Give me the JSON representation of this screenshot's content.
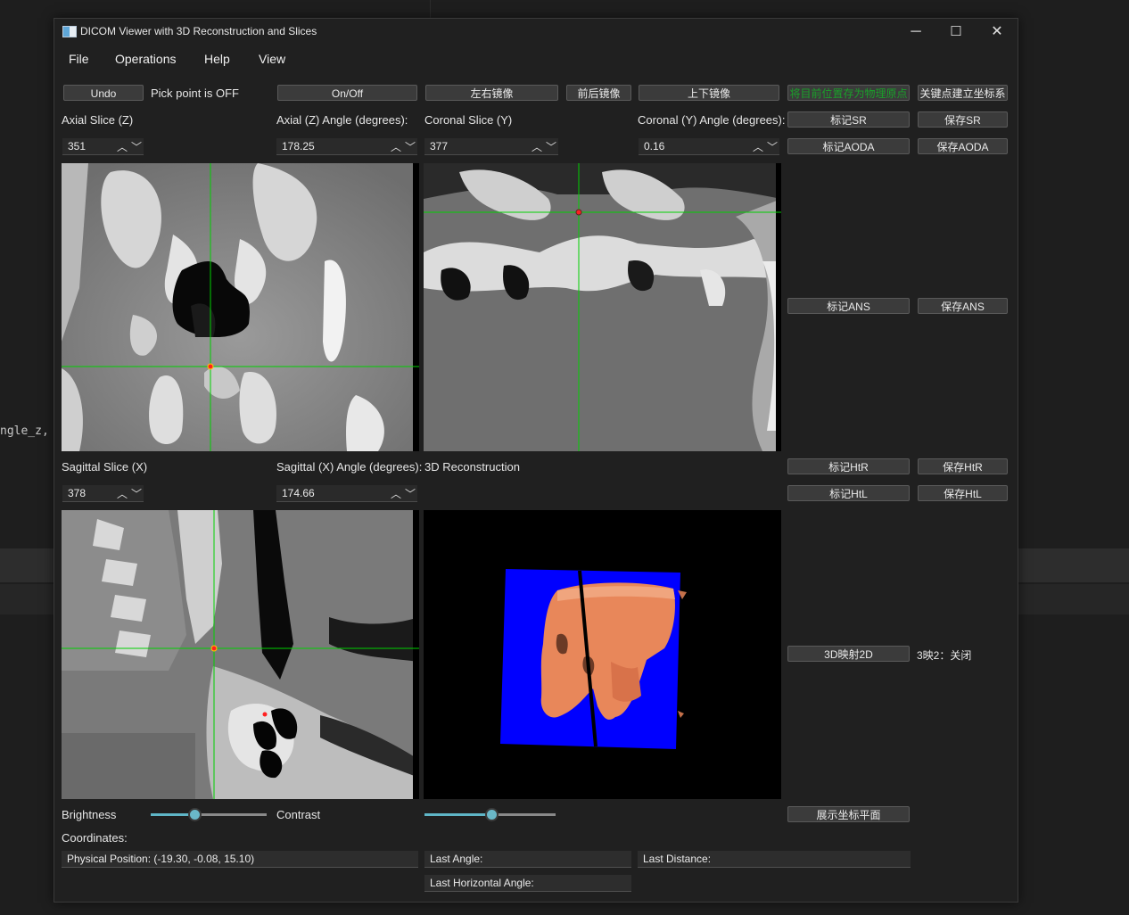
{
  "background": {
    "code_snippet": "ngle_z,"
  },
  "window": {
    "title": "DICOM Viewer with 3D Reconstruction and Slices",
    "controls": {
      "minimize": "─",
      "maximize": "☐",
      "close": "✕"
    }
  },
  "menu": [
    "File",
    "Operations",
    "Help",
    "View"
  ],
  "toolbar": {
    "undo": "Undo",
    "pick_status": "Pick point is OFF",
    "onoff": "On/Off",
    "mirror_lr": "左右镜像",
    "mirror_fb": "前后镜像",
    "mirror_ud": "上下镜像",
    "save_origin": "将目前位置存为物理原点",
    "build_coords": "关键点建立坐标系"
  },
  "axial": {
    "slice_label": "Axial Slice (Z)",
    "slice_value": "351",
    "angle_label": "Axial (Z) Angle (degrees):",
    "angle_value": "178.25"
  },
  "coronal": {
    "slice_label": "Coronal Slice (Y)",
    "slice_value": "377",
    "angle_label": "Coronal (Y) Angle (degrees):",
    "angle_value": "0.16"
  },
  "sagittal": {
    "slice_label": "Sagittal Slice (X)",
    "slice_value": "378",
    "angle_label": "Sagittal (X) Angle (degrees):",
    "angle_value": "174.66"
  },
  "recon_label": "3D Reconstruction",
  "right_panel": {
    "mark_sr": "标记SR",
    "save_sr": "保存SR",
    "mark_aoda": "标记AODA",
    "save_aoda": "保存AODA",
    "mark_ans": "标记ANS",
    "save_ans": "保存ANS",
    "mark_htr": "标记HtR",
    "save_htr": "保存HtR",
    "mark_htl": "标记HtL",
    "save_htl": "保存HtL",
    "map_3d_2d": "3D映射2D",
    "map_status": "3映2：关闭",
    "show_planes": "展示坐标平面"
  },
  "controls": {
    "brightness_label": "Brightness",
    "contrast_label": "Contrast",
    "brightness_level": 0.38,
    "contrast_level": 0.51
  },
  "coords": {
    "label": "Coordinates:",
    "physical_position": "Physical Position: (-19.30, -0.08, 15.10)",
    "last_angle": "Last Angle:",
    "last_distance": "Last Distance:",
    "last_horizontal_angle": "Last Horizontal Angle:"
  },
  "colors": {
    "crosshair": "#00d000",
    "marker": "#ff2020",
    "recon_plane": "#0000ff",
    "bone": "#e8875a",
    "accent_button_text": "#1aa02a",
    "slider": "#5fb6c7"
  }
}
